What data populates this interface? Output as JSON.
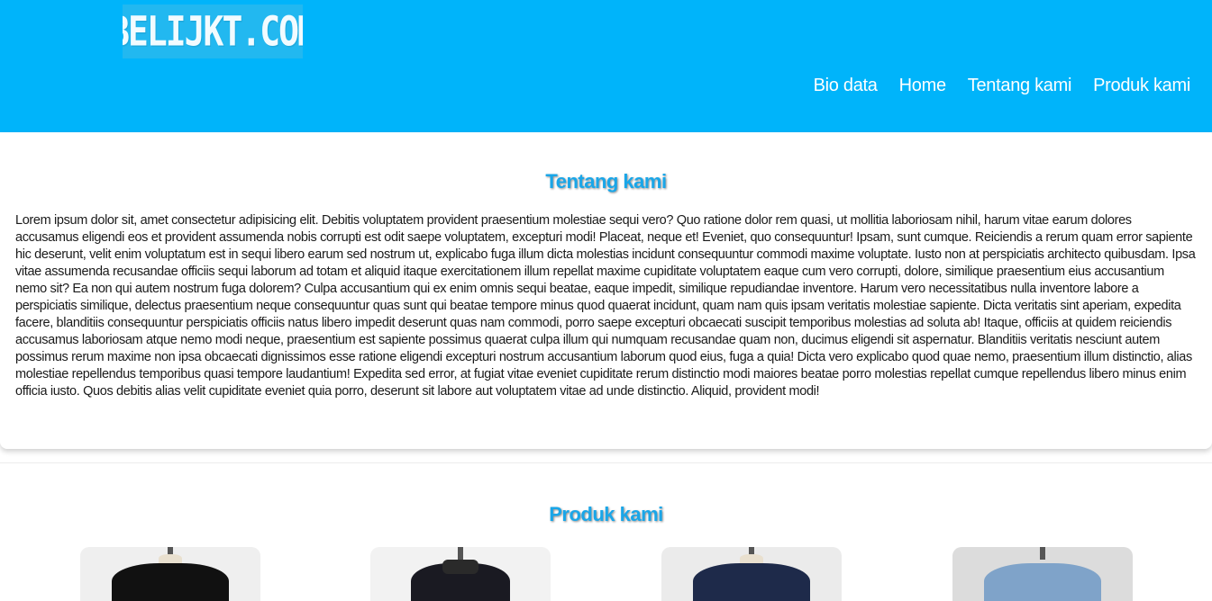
{
  "header": {
    "logo_text": "BELIJKT.COM",
    "background_color": "#00b4fa",
    "nav": [
      {
        "label": "Bio data"
      },
      {
        "label": "Home"
      },
      {
        "label": "Tentang kami"
      },
      {
        "label": "Produk kami"
      }
    ]
  },
  "about": {
    "title": "Tentang kami",
    "body": "Lorem ipsum dolor sit, amet consectetur adipisicing elit. Debitis voluptatem provident praesentium molestiae sequi vero? Quo ratione dolor rem quasi, ut mollitia laboriosam nihil, harum vitae earum dolores accusamus eligendi eos et provident assumenda nobis corrupti est odit saepe voluptatem, excepturi modi! Placeat, neque et! Eveniet, quo consequuntur! Ipsam, sunt cumque. Reiciendis a rerum quam error sapiente hic deserunt, velit enim voluptatum est in sequi libero earum sed nostrum ut, explicabo fuga illum dicta molestias incidunt consequuntur commodi maxime voluptate. Iusto non at perspiciatis architecto quibusdam. Ipsa vitae assumenda recusandae officiis sequi laborum ad totam et aliquid itaque exercitationem illum repellat maxime cupiditate voluptatem eaque cum vero corrupti, dolore, similique praesentium eius accusantium nemo sit? Ea non qui autem nostrum fuga dolorem? Culpa accusantium qui ex enim omnis sequi beatae, eaque impedit, similique repudiandae inventore. Harum vero necessitatibus nulla inventore labore a perspiciatis similique, delectus praesentium neque consequuntur quas sunt qui beatae tempore minus quod quaerat incidunt, quam nam quis ipsam veritatis molestiae sapiente. Dicta veritatis sint aperiam, expedita facere, blanditiis consequuntur perspiciatis officiis natus libero impedit deserunt quas nam commodi, porro saepe excepturi obcaecati suscipit temporibus molestias ad soluta ab! Itaque, officiis at quidem reiciendis accusamus laboriosam atque nemo modi neque, praesentium est sapiente possimus quaerat culpa illum qui numquam recusandae quam non, ducimus eligendi sit aspernatur. Blanditiis veritatis nesciunt autem possimus rerum maxime non ipsa obcaecati dignissimos esse ratione eligendi excepturi nostrum accusantium laborum quod eius, fuga a quia! Dicta vero explicabo quod quae nemo, praesentium illum distinctio, alias molestiae repellendus temporibus quasi tempore laudantium! Expedita sed error, at fugiat vitae eveniet cupiditate rerum distinctio modi maiores beatae porro molestias repellat cumque repellendus libero minus enim officia iusto. Quos debitis alias velit cupiditate eveniet quia porro, deserunt sit labore aut voluptatem vitae ad unde distinctio. Aliquid, provident modi!"
  },
  "products": {
    "title": "Produk kami",
    "items": [
      {
        "icon": "product-jacket-black-image"
      },
      {
        "icon": "product-jacket-dark-image"
      },
      {
        "icon": "product-jacket-navy-image"
      },
      {
        "icon": "product-jacket-denim-image"
      }
    ]
  },
  "colors": {
    "accent": "#00b4fa",
    "title": "#1aa6e8"
  }
}
